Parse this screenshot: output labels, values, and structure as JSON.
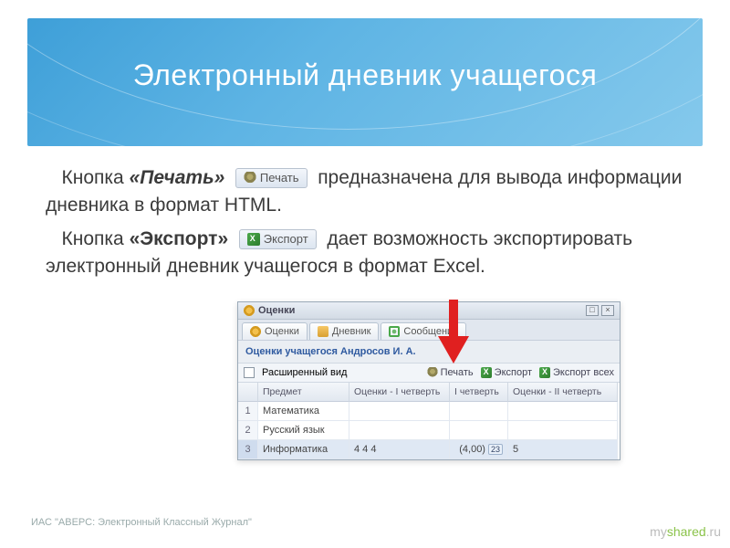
{
  "slide": {
    "title": "Электронный дневник учащегося",
    "para1": {
      "t1": "Кнопка ",
      "bold": "«Печать»",
      "btn_label": "Печать",
      "t2": " предназначена для вывода информации дневника в формат HTML."
    },
    "para2": {
      "t1": "Кнопка ",
      "bold": "«Экспорт»",
      "btn_label": "Экспорт",
      "t2": " дает возможность экспортировать электронный дневник учащегося в формат Excel."
    },
    "footer_left": "ИАС \"АВЕРС: Электронный Классный Журнал\"",
    "footer_right_a": "my",
    "footer_right_b": "shared",
    "footer_right_c": ".ru"
  },
  "app": {
    "title": "Оценки",
    "tabs": {
      "t1": "Оценки",
      "t2": "Дневник",
      "t3": "Сообщения"
    },
    "student_label": "Оценки учащегося Андросов И. А.",
    "toolbar": {
      "extended_view": "Расширенный вид",
      "print": "Печать",
      "export": "Экспорт",
      "export_all": "Экспорт всех"
    },
    "columns": {
      "c0": "",
      "c1": "Предмет",
      "c2": "Оценки - I четверть",
      "c3": "I четверть",
      "c4": "Оценки - II четверть"
    },
    "rows": [
      {
        "n": "1",
        "subject": "Математика",
        "g1": "",
        "avg": "",
        "g2": ""
      },
      {
        "n": "2",
        "subject": "Русский язык",
        "g1": "",
        "avg": "",
        "g2": ""
      },
      {
        "n": "3",
        "subject": "Информатика",
        "g1": "4 4 4",
        "avg": "(4,00)",
        "avg_badge": "23",
        "g2": "5"
      }
    ]
  }
}
